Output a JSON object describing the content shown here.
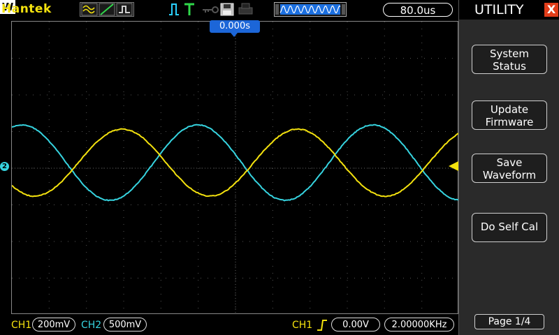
{
  "brand": "Hantek",
  "colors": {
    "ch1": "#f4e20e",
    "ch2": "#36d4e0",
    "trigger_marker": "#1c66d8",
    "close": "#e23d1a"
  },
  "icons": [
    "ac-coupling-icon",
    "dc-coupling-icon",
    "gnd-icon",
    "run-pulse-icon",
    "trigger-t-icon",
    "key-icon",
    "save-icon",
    "print-icon",
    "timebase-window-icon"
  ],
  "header": {
    "window_badge": "W",
    "timebase": "80.0us"
  },
  "scope": {
    "trigger_position": "0.000s",
    "ch2_marker": "2"
  },
  "bottom": {
    "ch1_label": "CH1",
    "ch1_scale": "200mV",
    "ch2_label": "CH2",
    "ch2_scale": "500mV",
    "trigger_source": "CH1",
    "trigger_level": "0.00V",
    "frequency": "2.00000KHz"
  },
  "menu": {
    "title": "UTILITY",
    "close": "X",
    "buttons": [
      {
        "line1": "System",
        "line2": "Status"
      },
      {
        "line1": "Update",
        "line2": "Firmware"
      },
      {
        "line1": "Save",
        "line2": "Waveform"
      },
      {
        "line1": "Do Self Cal"
      }
    ],
    "page_indicator": "Page 1/4"
  }
}
